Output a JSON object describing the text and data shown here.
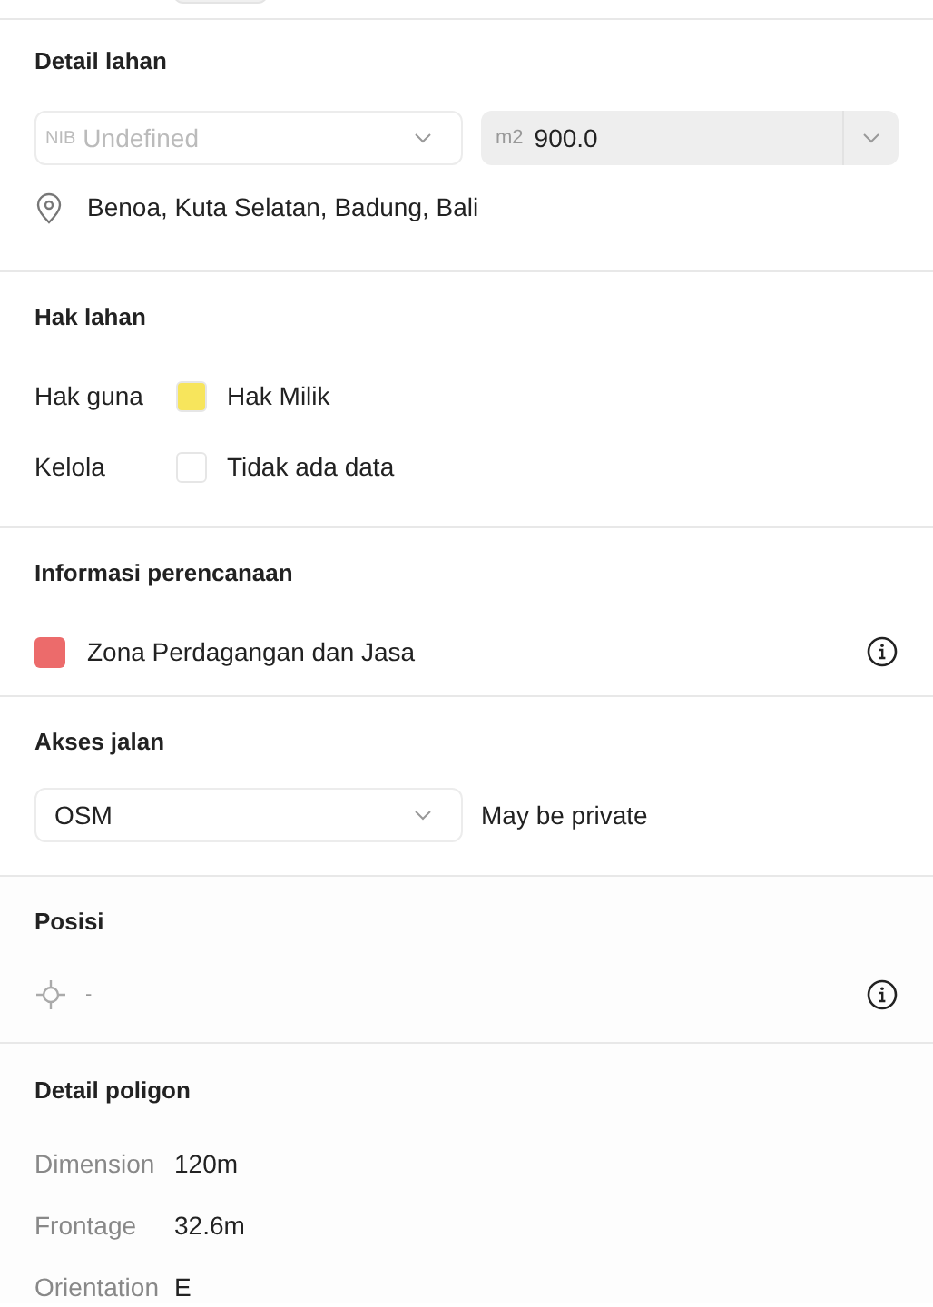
{
  "detail_lahan": {
    "title": "Detail lahan",
    "nib_field": {
      "prefix": "NIB",
      "placeholder": "Undefined"
    },
    "area_field": {
      "prefix": "m2",
      "value": "900.0"
    },
    "address": "Benoa, Kuta Selatan, Badung, Bali"
  },
  "hak_lahan": {
    "title": "Hak lahan",
    "rows": [
      {
        "label": "Hak guna",
        "value": "Hak Milik",
        "color": "#f7e55c"
      },
      {
        "label": "Kelola",
        "value": "Tidak ada data",
        "color": "#ffffff"
      }
    ]
  },
  "informasi_perencanaan": {
    "title": "Informasi perencanaan",
    "zone": {
      "label": "Zona Perdagangan dan Jasa",
      "color": "#ec6b6b"
    }
  },
  "akses_jalan": {
    "title": "Akses jalan",
    "source": "OSM",
    "note": "May be private"
  },
  "posisi": {
    "title": "Posisi",
    "value": "-"
  },
  "detail_poligon": {
    "title": "Detail poligon",
    "rows": [
      {
        "label": "Dimension",
        "value": "120m"
      },
      {
        "label": "Frontage",
        "value": "32.6m"
      },
      {
        "label": "Orientation",
        "value": "E"
      }
    ]
  }
}
